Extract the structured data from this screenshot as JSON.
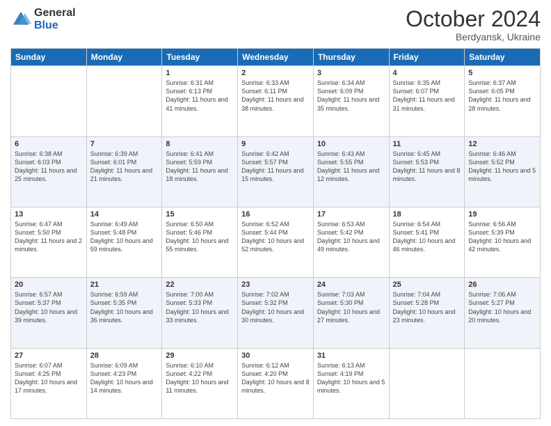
{
  "logo": {
    "general": "General",
    "blue": "Blue"
  },
  "title": {
    "month_year": "October 2024",
    "location": "Berdyansk, Ukraine"
  },
  "weekdays": [
    "Sunday",
    "Monday",
    "Tuesday",
    "Wednesday",
    "Thursday",
    "Friday",
    "Saturday"
  ],
  "weeks": [
    [
      {
        "day": "",
        "info": ""
      },
      {
        "day": "",
        "info": ""
      },
      {
        "day": "1",
        "info": "Sunrise: 6:31 AM\nSunset: 6:13 PM\nDaylight: 11 hours and 41 minutes."
      },
      {
        "day": "2",
        "info": "Sunrise: 6:33 AM\nSunset: 6:11 PM\nDaylight: 11 hours and 38 minutes."
      },
      {
        "day": "3",
        "info": "Sunrise: 6:34 AM\nSunset: 6:09 PM\nDaylight: 11 hours and 35 minutes."
      },
      {
        "day": "4",
        "info": "Sunrise: 6:35 AM\nSunset: 6:07 PM\nDaylight: 11 hours and 31 minutes."
      },
      {
        "day": "5",
        "info": "Sunrise: 6:37 AM\nSunset: 6:05 PM\nDaylight: 11 hours and 28 minutes."
      }
    ],
    [
      {
        "day": "6",
        "info": "Sunrise: 6:38 AM\nSunset: 6:03 PM\nDaylight: 11 hours and 25 minutes."
      },
      {
        "day": "7",
        "info": "Sunrise: 6:39 AM\nSunset: 6:01 PM\nDaylight: 11 hours and 21 minutes."
      },
      {
        "day": "8",
        "info": "Sunrise: 6:41 AM\nSunset: 5:59 PM\nDaylight: 11 hours and 18 minutes."
      },
      {
        "day": "9",
        "info": "Sunrise: 6:42 AM\nSunset: 5:57 PM\nDaylight: 11 hours and 15 minutes."
      },
      {
        "day": "10",
        "info": "Sunrise: 6:43 AM\nSunset: 5:55 PM\nDaylight: 11 hours and 12 minutes."
      },
      {
        "day": "11",
        "info": "Sunrise: 6:45 AM\nSunset: 5:53 PM\nDaylight: 11 hours and 8 minutes."
      },
      {
        "day": "12",
        "info": "Sunrise: 6:46 AM\nSunset: 5:52 PM\nDaylight: 11 hours and 5 minutes."
      }
    ],
    [
      {
        "day": "13",
        "info": "Sunrise: 6:47 AM\nSunset: 5:50 PM\nDaylight: 11 hours and 2 minutes."
      },
      {
        "day": "14",
        "info": "Sunrise: 6:49 AM\nSunset: 5:48 PM\nDaylight: 10 hours and 59 minutes."
      },
      {
        "day": "15",
        "info": "Sunrise: 6:50 AM\nSunset: 5:46 PM\nDaylight: 10 hours and 55 minutes."
      },
      {
        "day": "16",
        "info": "Sunrise: 6:52 AM\nSunset: 5:44 PM\nDaylight: 10 hours and 52 minutes."
      },
      {
        "day": "17",
        "info": "Sunrise: 6:53 AM\nSunset: 5:42 PM\nDaylight: 10 hours and 49 minutes."
      },
      {
        "day": "18",
        "info": "Sunrise: 6:54 AM\nSunset: 5:41 PM\nDaylight: 10 hours and 46 minutes."
      },
      {
        "day": "19",
        "info": "Sunrise: 6:56 AM\nSunset: 5:39 PM\nDaylight: 10 hours and 42 minutes."
      }
    ],
    [
      {
        "day": "20",
        "info": "Sunrise: 6:57 AM\nSunset: 5:37 PM\nDaylight: 10 hours and 39 minutes."
      },
      {
        "day": "21",
        "info": "Sunrise: 6:59 AM\nSunset: 5:35 PM\nDaylight: 10 hours and 36 minutes."
      },
      {
        "day": "22",
        "info": "Sunrise: 7:00 AM\nSunset: 5:33 PM\nDaylight: 10 hours and 33 minutes."
      },
      {
        "day": "23",
        "info": "Sunrise: 7:02 AM\nSunset: 5:32 PM\nDaylight: 10 hours and 30 minutes."
      },
      {
        "day": "24",
        "info": "Sunrise: 7:03 AM\nSunset: 5:30 PM\nDaylight: 10 hours and 27 minutes."
      },
      {
        "day": "25",
        "info": "Sunrise: 7:04 AM\nSunset: 5:28 PM\nDaylight: 10 hours and 23 minutes."
      },
      {
        "day": "26",
        "info": "Sunrise: 7:06 AM\nSunset: 5:27 PM\nDaylight: 10 hours and 20 minutes."
      }
    ],
    [
      {
        "day": "27",
        "info": "Sunrise: 6:07 AM\nSunset: 4:25 PM\nDaylight: 10 hours and 17 minutes."
      },
      {
        "day": "28",
        "info": "Sunrise: 6:09 AM\nSunset: 4:23 PM\nDaylight: 10 hours and 14 minutes."
      },
      {
        "day": "29",
        "info": "Sunrise: 6:10 AM\nSunset: 4:22 PM\nDaylight: 10 hours and 11 minutes."
      },
      {
        "day": "30",
        "info": "Sunrise: 6:12 AM\nSunset: 4:20 PM\nDaylight: 10 hours and 8 minutes."
      },
      {
        "day": "31",
        "info": "Sunrise: 6:13 AM\nSunset: 4:19 PM\nDaylight: 10 hours and 5 minutes."
      },
      {
        "day": "",
        "info": ""
      },
      {
        "day": "",
        "info": ""
      }
    ]
  ]
}
